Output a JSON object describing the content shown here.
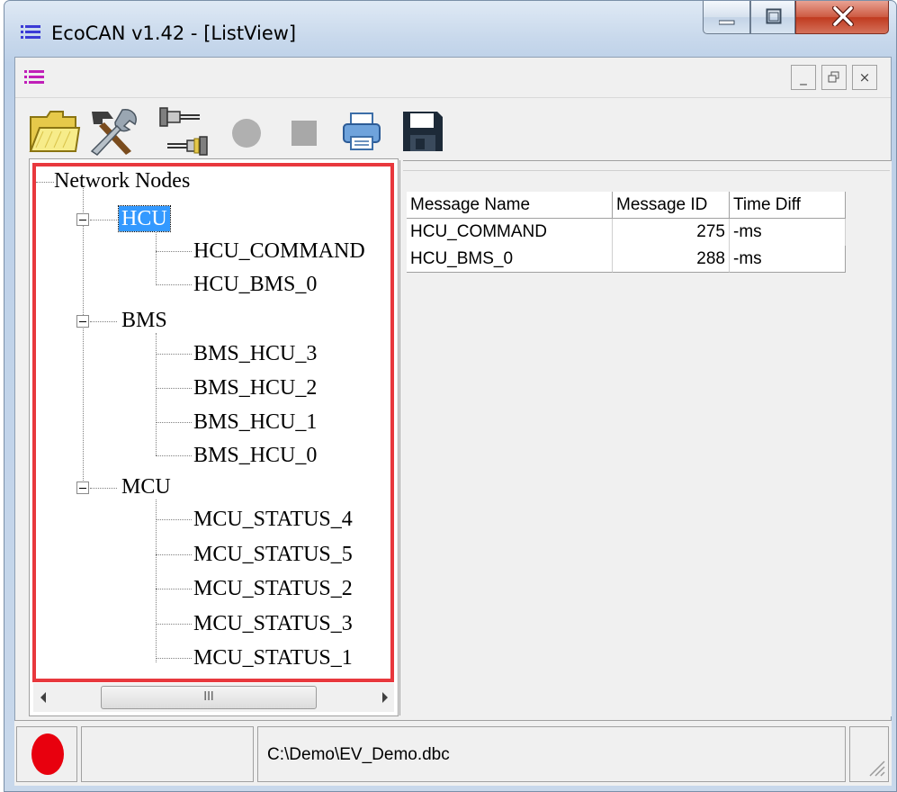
{
  "window": {
    "title": "EcoCAN v1.42 - [ListView]",
    "controls": {
      "minimize": "minimize-icon",
      "maximize": "maximize-icon",
      "close": "close-icon"
    }
  },
  "mdi": {
    "icon": "list-icon",
    "controls": {
      "minimize": "_",
      "restore": "restore-icon",
      "close": "×"
    }
  },
  "toolbar": {
    "items": [
      "open-folder-icon",
      "tools-icon",
      "connect-icon",
      "record-icon",
      "stop-icon",
      "print-icon",
      "save-icon"
    ]
  },
  "tree": {
    "root": "Network Nodes",
    "nodes": [
      {
        "label": "HCU",
        "selected": true,
        "children": [
          "HCU_COMMAND",
          "HCU_BMS_0"
        ]
      },
      {
        "label": "BMS",
        "selected": false,
        "children": [
          "BMS_HCU_3",
          "BMS_HCU_2",
          "BMS_HCU_1",
          "BMS_HCU_0"
        ]
      },
      {
        "label": "MCU",
        "selected": false,
        "children": [
          "MCU_STATUS_4",
          "MCU_STATUS_5",
          "MCU_STATUS_2",
          "MCU_STATUS_3",
          "MCU_STATUS_1"
        ]
      }
    ],
    "scrollbar_thumb_glyph": "III"
  },
  "list": {
    "columns": [
      "Message Name",
      "Message ID",
      "Time Diff"
    ],
    "rows": [
      {
        "name": "HCU_COMMAND",
        "id": "275",
        "diff": "-ms"
      },
      {
        "name": "HCU_BMS_0",
        "id": "288",
        "diff": "-ms"
      }
    ]
  },
  "status": {
    "indicator_color": "#e8000e",
    "file_path": "C:\\Demo\\EV_Demo.dbc"
  },
  "colors": {
    "selection": "#3399ff",
    "highlight_border": "#e8383d"
  }
}
